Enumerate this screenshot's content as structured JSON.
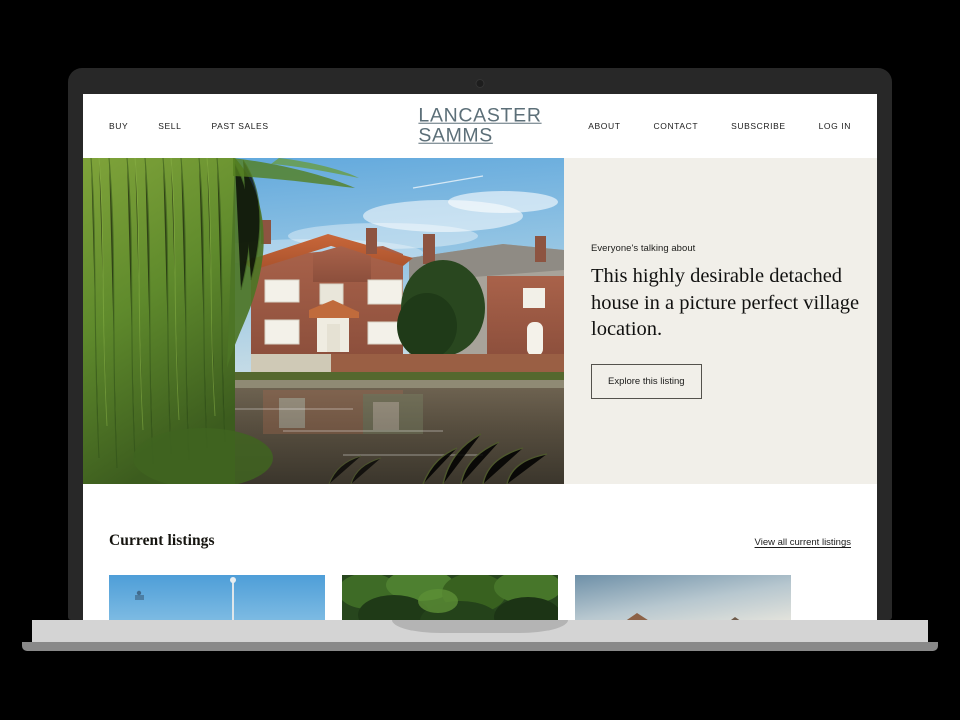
{
  "brand": {
    "line1": "LANCASTER",
    "line2": "SAMMS",
    "color": "#5c6f78"
  },
  "nav": {
    "left": [
      {
        "label": "BUY"
      },
      {
        "label": "SELL"
      },
      {
        "label": "PAST SALES"
      }
    ],
    "right": [
      {
        "label": "ABOUT"
      },
      {
        "label": "CONTACT"
      },
      {
        "label": "SUBSCRIBE"
      },
      {
        "label": "LOG IN"
      }
    ]
  },
  "hero": {
    "eyebrow": "Everyone's talking about",
    "headline": "This highly desirable detached house in a picture perfect village location.",
    "cta_label": "Explore this listing",
    "panel_color": "#f1efe9",
    "photo_alt": "Red brick detached house beside a village pond with a weeping willow"
  },
  "listings": {
    "title": "Current listings",
    "view_all_label": "View all current listings",
    "cards": [
      {
        "alt": "Blue sky above a property with a flagpole"
      },
      {
        "alt": "Aerial view of dense green treetops"
      },
      {
        "alt": "Rooftops silhouetted against a pale sky"
      }
    ]
  },
  "device": {
    "frame_color": "#282828",
    "base_color": "#d4d4d4",
    "foot_color": "#898989",
    "background_color": "#000000"
  }
}
